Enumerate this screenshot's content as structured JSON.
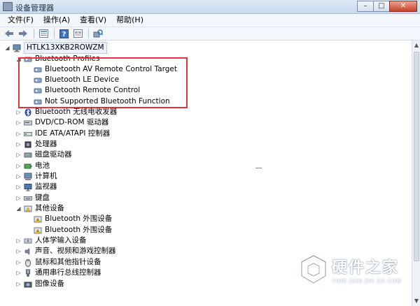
{
  "window": {
    "title": "设备管理器",
    "minimize": "–",
    "maximize": "□",
    "close": "✕"
  },
  "menu": [
    "文件(F)",
    "操作(A)",
    "查看(V)",
    "帮助(H)"
  ],
  "toolbar": [
    "back-arrow-icon",
    "forward-arrow-icon",
    "properties-grid-icon",
    "help-icon",
    "show-hidden-icon",
    "scan-hardware-icon"
  ],
  "tree": {
    "root": "HTLK13XKB2ROWZM",
    "bluetooth_profiles": {
      "label": "Bluetooth Profiles",
      "children": [
        "Bluetooth AV Remote Control Target",
        "Bluetooth LE Device",
        "Bluetooth Remote Control",
        "Not Supported Bluetooth Function"
      ]
    },
    "categories_a": [
      "Bluetooth 无线电收发器",
      "DVD/CD-ROM 驱动器",
      "IDE ATA/ATAPI 控制器",
      "处理器",
      "磁盘驱动器",
      "电池",
      "计算机",
      "监视器",
      "键盘"
    ],
    "other_devices": {
      "label": "其他设备",
      "children": [
        "Bluetooth 外围设备",
        "Bluetooth 外围设备"
      ]
    },
    "categories_b": [
      "人体学输入设备",
      "声音、视频和游戏控制器",
      "鼠标和其他指针设备",
      "通用串行总线控制器",
      "图像设备"
    ]
  },
  "watermark": {
    "title": "硬件之家",
    "subtitle": "YING JIAN ZHI JIA.COM"
  },
  "colors": {
    "highlight": "#e0343e",
    "selected_bg": "#eaf1fa"
  }
}
